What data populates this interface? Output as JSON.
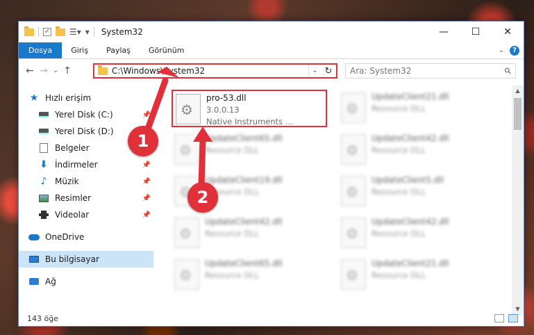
{
  "titlebar": {
    "title": "System32",
    "minimize_glyph": "—",
    "maximize_glyph": "☐",
    "close_glyph": "✕"
  },
  "ribbon": {
    "tabs": [
      "Dosya",
      "Giriş",
      "Paylaş",
      "Görünüm"
    ]
  },
  "navbar": {
    "back": "←",
    "forward": "→",
    "recent": "⌄",
    "up": "↑",
    "address": "C:\\Windows\\System32",
    "search_placeholder": "Ara: System32"
  },
  "sidebar": {
    "items": [
      {
        "label": "Hızlı erişim",
        "icon": "star-icon"
      },
      {
        "label": "Yerel Disk (C:)",
        "icon": "disk-icon",
        "pinned": true
      },
      {
        "label": "Yerel Disk (D:)",
        "icon": "disk-icon",
        "pinned": true
      },
      {
        "label": "Belgeler",
        "icon": "document-icon",
        "pinned": true
      },
      {
        "label": "İndirmeler",
        "icon": "download-icon",
        "pinned": true
      },
      {
        "label": "Müzik",
        "icon": "music-icon",
        "pinned": true
      },
      {
        "label": "Resimler",
        "icon": "pictures-icon",
        "pinned": true
      },
      {
        "label": "Videolar",
        "icon": "videos-icon",
        "pinned": true
      },
      {
        "label": "OneDrive",
        "icon": "cloud-icon"
      },
      {
        "label": "Bu bilgisayar",
        "icon": "computer-icon",
        "selected": true
      },
      {
        "label": "Ağ",
        "icon": "network-icon"
      }
    ]
  },
  "files": [
    {
      "name": "pro-53.dll",
      "line2": "3.0.0.13",
      "line3": "Native Instruments ..."
    },
    {
      "name": "UpdateClient21.dll",
      "line2": "Resource DLL"
    },
    {
      "name": "UpdateClient65.dll",
      "line2": "Resource DLL"
    },
    {
      "name": "UpdateClient42.dll",
      "line2": "Resource DLL"
    },
    {
      "name": "UpdateClient19.dll",
      "line2": "Resource DLL"
    },
    {
      "name": "UpdateClient5.dll",
      "line2": "Resource DLL"
    },
    {
      "name": "UpdateClient42.dll",
      "line2": "Resource DLL"
    },
    {
      "name": "UpdateClient42.dll",
      "line2": "Resource DLL"
    },
    {
      "name": "UpdateClient65.dll",
      "line2": "Resource DLL"
    },
    {
      "name": "UpdateClient21.dll",
      "line2": "Resource DLL"
    }
  ],
  "status": {
    "count": "143 öğe"
  },
  "callouts": {
    "one": "1",
    "two": "2"
  },
  "colors": {
    "accent": "#1979ca",
    "highlight": "#e0303a",
    "selection": "#cce4f7"
  }
}
